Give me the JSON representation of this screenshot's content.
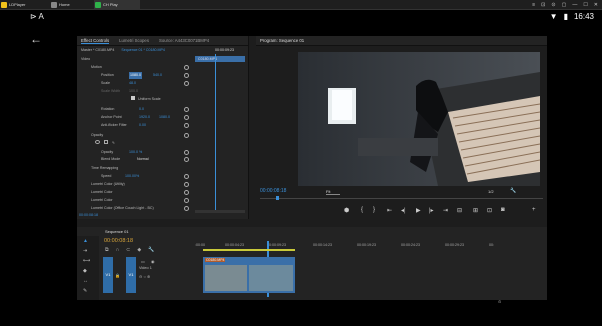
{
  "browser": {
    "tabs": [
      {
        "label": "LDPlayer",
        "color": "#f2c21b"
      },
      {
        "label": "Home",
        "color": "#888888"
      },
      {
        "label": "CH Play",
        "color": "#2fb24a"
      }
    ],
    "controls": [
      "≡",
      "⊡",
      "⊙",
      "▢",
      "—",
      "☐",
      "✕"
    ]
  },
  "status": {
    "left_icons": "⊳ A",
    "time": "16:43"
  },
  "back_label": "←",
  "effect_controls": {
    "tabs": [
      "Effect Controls",
      "Lumetri Scopes",
      "Source: A443C0071BMP4"
    ],
    "master": "Master * C0180.MP4",
    "sequence": "Sequence 01 * C0180.MP4",
    "timecode_top": "00:00:09:23",
    "clip_label": "C0180.MP4",
    "video_label": "Video",
    "motion": "Motion",
    "position": {
      "label": "Position",
      "x": "1080.0",
      "y": "540.0"
    },
    "scale": {
      "label": "Scale",
      "value": "48.0"
    },
    "scale_width": {
      "label": "Scale Width",
      "value": "100.0"
    },
    "uniform": "Uniform Scale",
    "rotation": {
      "label": "Rotation",
      "value": "0.0"
    },
    "anchor": {
      "label": "Anchor Point",
      "x": "1920.0",
      "y": "1080.0"
    },
    "antiflicker": {
      "label": "Anti-flicker Filter",
      "value": "0.00"
    },
    "opacity_section": "Opacity",
    "opacity": {
      "label": "Opacity",
      "value": "100.0 %"
    },
    "blend": {
      "label": "Blend Mode",
      "value": "Normal"
    },
    "time_remap": "Time Remapping",
    "speed": {
      "label": "Speed",
      "value": "100.00%"
    },
    "lumetri": [
      "Lumetri Color (Utility)",
      "Lumetri Color",
      "Lumetri Color",
      "Lumetri Color (Office Couch Light - BC)"
    ],
    "timecode_bottom": "00:00:08:18"
  },
  "program": {
    "title": "Program: Sequence 01",
    "timecode": "00:00:08:18",
    "fit": "Fit",
    "fraction": "1/2"
  },
  "timeline": {
    "tab": "Sequence 01",
    "timecode": "00:00:08:18",
    "ruler": [
      ":00:00",
      "00:00:04:23",
      "00:00:09:23",
      "00:00:14:23",
      "00:00:19:23",
      "00:00:24:23",
      "00:00:29:23",
      "00:"
    ],
    "v1": "V1",
    "video1": "Video 1",
    "clip_label": "C0180.MP4"
  }
}
